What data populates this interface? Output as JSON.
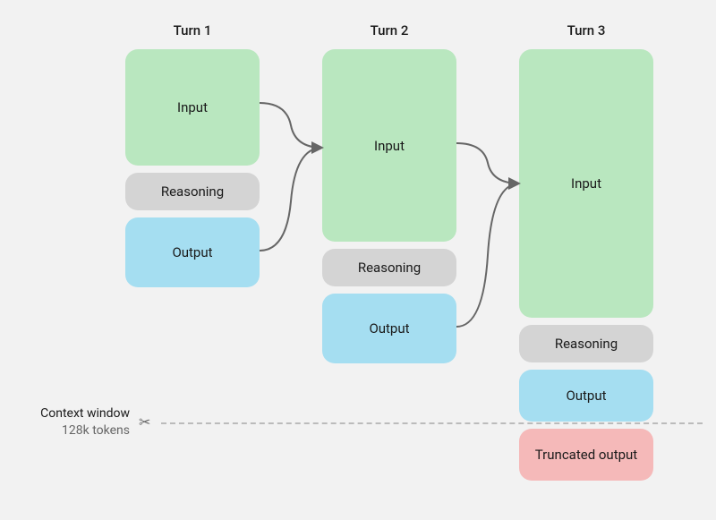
{
  "headers": {
    "turn1": "Turn 1",
    "turn2": "Turn 2",
    "turn3": "Turn 3"
  },
  "blocks": {
    "input": "Input",
    "reasoning": "Reasoning",
    "output": "Output",
    "truncated": "Truncated output"
  },
  "context": {
    "label": "Context window",
    "tokens": "128k tokens"
  },
  "colors": {
    "input": "#b9e7bf",
    "reasoning": "#d4d4d4",
    "output": "#a5def1",
    "truncated": "#f5b9b9",
    "background": "#f2f2f2",
    "arrow": "#666"
  }
}
